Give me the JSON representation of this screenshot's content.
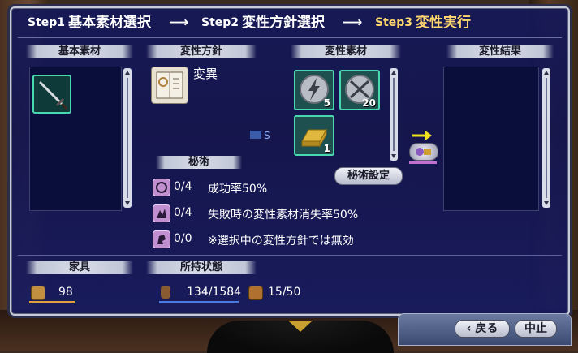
{
  "steps": {
    "step1_prefix": "Step1",
    "step1_label": "基本素材選択",
    "arrow": "⟶",
    "step2_prefix": "Step2",
    "step2_label": "変性方針選択",
    "step3_prefix": "Step3",
    "step3_label": "変性実行"
  },
  "sections": {
    "base_material": "基本素材",
    "policy": "変性方針",
    "mutation_material": "変性素材",
    "result": "変性結果",
    "secret_art": "秘術",
    "furniture": "家具",
    "possession": "所持状態"
  },
  "policy": {
    "name": "変異",
    "icon": "book-icon"
  },
  "base_material": {
    "items": [
      {
        "icon": "dagger-icon"
      }
    ]
  },
  "mutation_materials": [
    {
      "icon": "silver-coin-lightning-icon",
      "count": "5"
    },
    {
      "icon": "silver-coin-blades-icon",
      "count": "20"
    },
    {
      "icon": "gold-ingot-icon",
      "count": "1"
    }
  ],
  "mid_indicator": "S",
  "secret_button": "秘術設定",
  "secret_arts": [
    {
      "icon": "clover-icon",
      "count": "0/4",
      "desc": "成功率50%"
    },
    {
      "icon": "spark-icon",
      "count": "0/4",
      "desc": "失敗時の変性素材消失率50%"
    },
    {
      "icon": "horse-icon",
      "count": "0/0",
      "desc": "※選択中の変性方針では無効"
    }
  ],
  "furniture": {
    "value": "98"
  },
  "possession": {
    "weight": "134/1584",
    "storage": "15/50"
  },
  "buttons": {
    "back": "戻る",
    "back_prefix": "‹",
    "stop": "中止"
  },
  "colors": {
    "window_bg": "#141858",
    "active_step": "#ffd66e",
    "slot_border": "#4ad8b0"
  }
}
